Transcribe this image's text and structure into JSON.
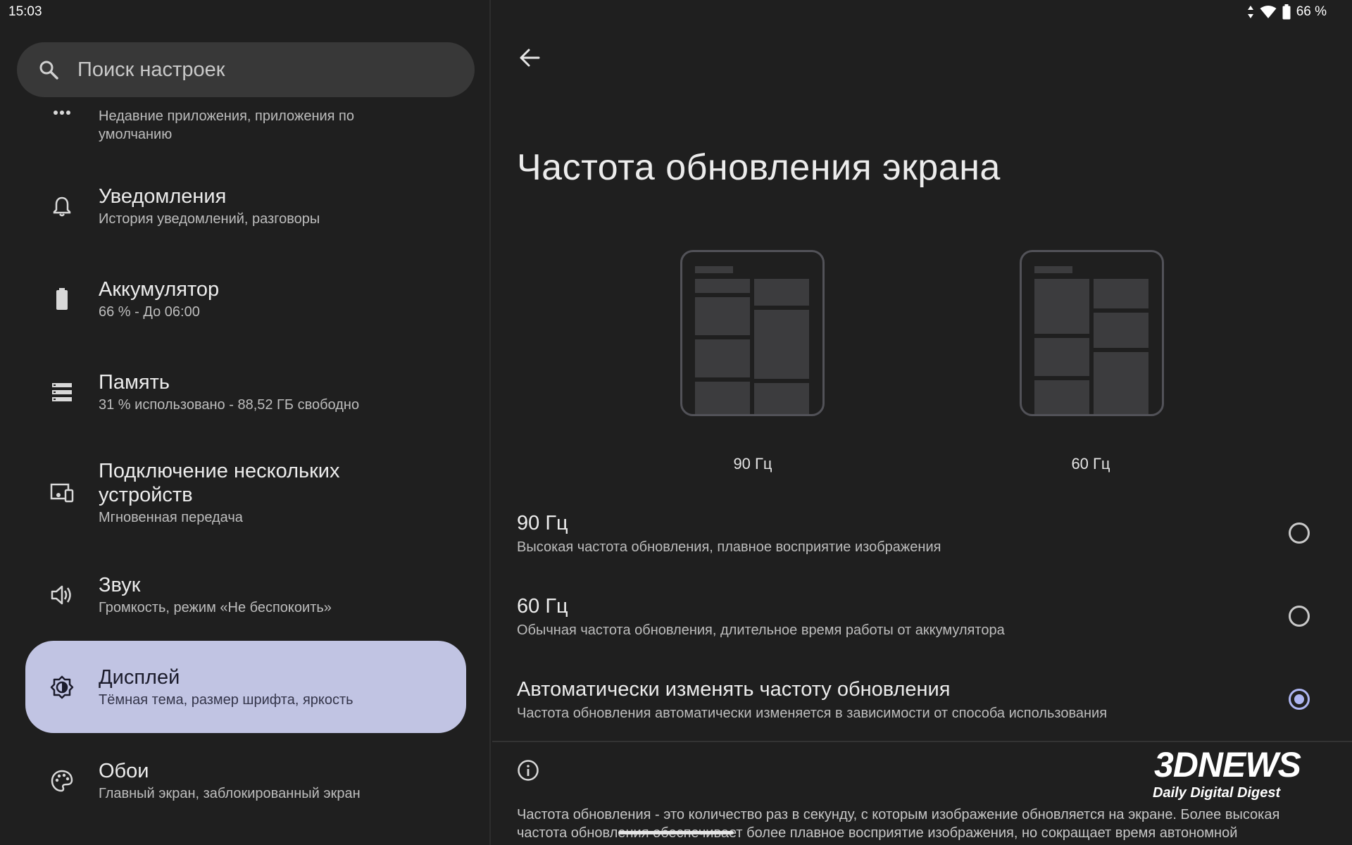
{
  "status_bar": {
    "time": "15:03",
    "battery_text": "66 %",
    "icons": [
      "data-arrows-icon",
      "wifi-icon",
      "battery-icon"
    ]
  },
  "search": {
    "placeholder": "Поиск настроек",
    "icon": "search-icon"
  },
  "sidebar": {
    "items": [
      {
        "icon": "more-dots-icon",
        "title": "",
        "subtitle_line1": "Недавние приложения, приложения по",
        "subtitle_line2": "умолчанию"
      },
      {
        "icon": "bell-icon",
        "title": "Уведомления",
        "subtitle": "История уведомлений, разговоры"
      },
      {
        "icon": "battery-icon",
        "title": "Аккумулятор",
        "subtitle": "66 % - До 06:00"
      },
      {
        "icon": "storage-icon",
        "title": "Память",
        "subtitle": "31 % использовано - 88,52 ГБ свободно"
      },
      {
        "icon": "devices-icon",
        "title_line1": "Подключение нескольких",
        "title_line2": "устройств",
        "subtitle": "Мгновенная передача"
      },
      {
        "icon": "speaker-icon",
        "title": "Звук",
        "subtitle": "Громкость, режим «Не беспокоить»"
      },
      {
        "icon": "display-brightness-icon",
        "title": "Дисплей",
        "subtitle": "Тёмная тема, размер шрифта, яркость",
        "selected": true
      },
      {
        "icon": "palette-icon",
        "title": "Обои",
        "subtitle": "Главный экран, заблокированный экран"
      }
    ]
  },
  "main": {
    "title": "Частота обновления экрана",
    "previews": [
      {
        "label": "90 Гц"
      },
      {
        "label": "60 Гц"
      }
    ],
    "options": [
      {
        "title": "90 Гц",
        "subtitle": "Высокая частота обновления, плавное восприятие изображения",
        "checked": false
      },
      {
        "title": "60 Гц",
        "subtitle": "Обычная частота обновления, длительное время работы от аккумулятора",
        "checked": false
      },
      {
        "title": "Автоматически изменять частоту обновления",
        "subtitle": "Частота обновления автоматически изменяется в зависимости от способа использования",
        "checked": true
      }
    ],
    "info_line1": "Частота обновления - это количество раз в секунду, с которым изображение обновляется на экране. Более высокая",
    "info_line2": "частота обновления обеспечивает более плавное восприятие изображения, но сокращает время автономной"
  },
  "watermark": {
    "main": "3DNEWS",
    "sub": "Daily Digital Digest"
  },
  "colors": {
    "background": "#1f1f1f",
    "selected_item": "#c1c4e3",
    "radio_checked": "#aeb6f2"
  }
}
